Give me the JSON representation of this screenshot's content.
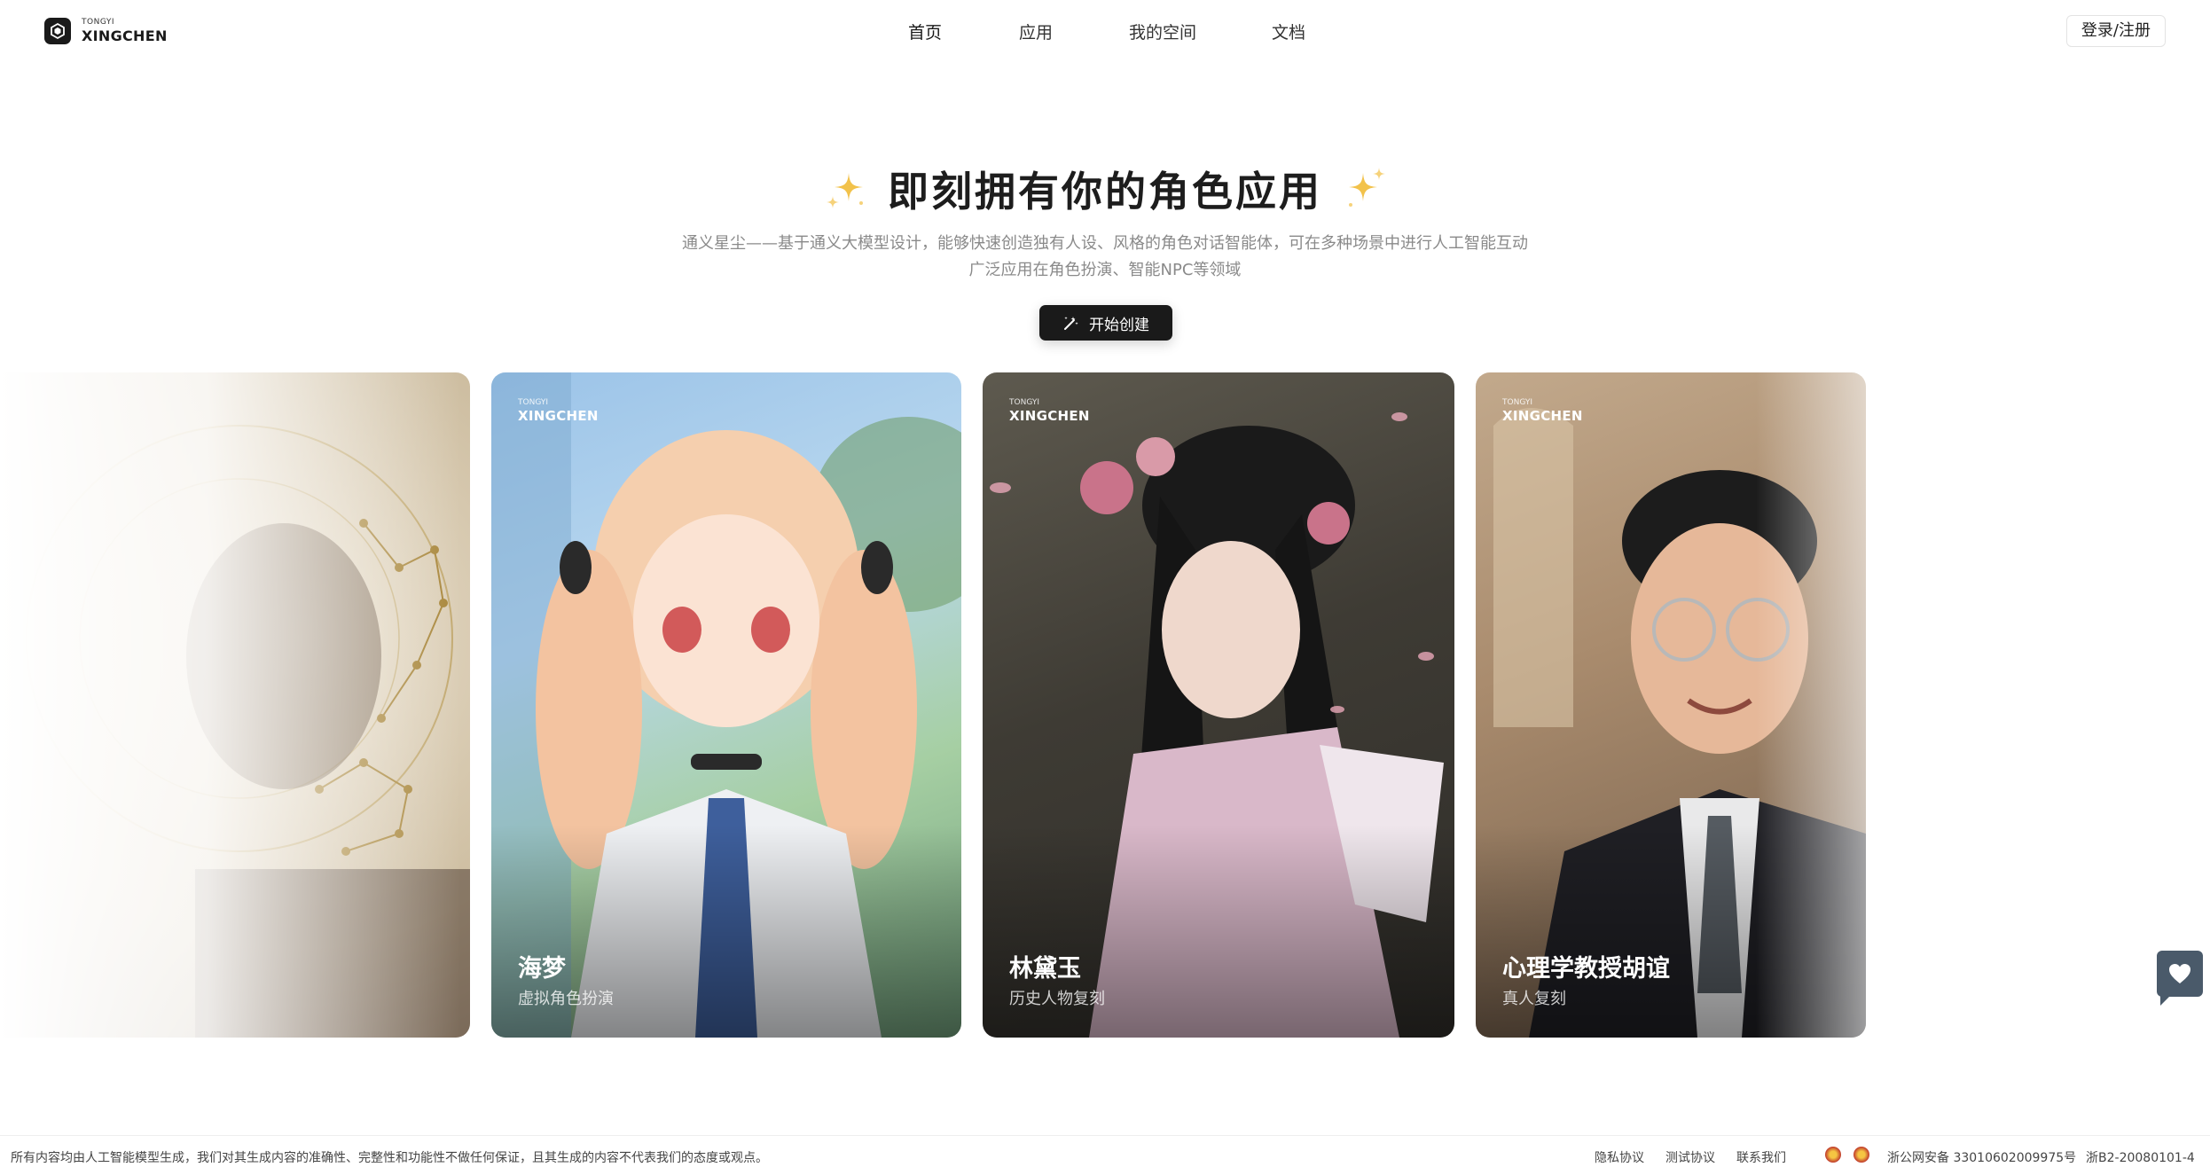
{
  "header": {
    "logo_small": "TONGYI",
    "logo_big": "XINGCHEN",
    "nav": [
      "首页",
      "应用",
      "我的空间",
      "文档"
    ],
    "active_nav": "首页",
    "login_label": "登录/注册"
  },
  "hero": {
    "title": "即刻拥有你的角色应用",
    "subtitle_line1": "通义星尘——基于通义大模型设计，能够快速创造独有人设、风格的角色对话智能体，可在多种场景中进行人工智能互动",
    "subtitle_line2": "广泛应用在角色扮演、智能NPC等领域",
    "create_label": "开始创建",
    "sparkle_color": "#f2c24b"
  },
  "cards": [
    {
      "brand_small": "",
      "brand_big": "",
      "name": "",
      "tag": ""
    },
    {
      "brand_small": "TONGYI",
      "brand_big": "XINGCHEN",
      "name": "海梦",
      "tag": "虚拟角色扮演"
    },
    {
      "brand_small": "TONGYI",
      "brand_big": "XINGCHEN",
      "name": "林黛玉",
      "tag": "历史人物复刻"
    },
    {
      "brand_small": "TONGYI",
      "brand_big": "XINGCHEN",
      "name": "心理学教授胡谊",
      "tag": "真人复刻"
    }
  ],
  "footer": {
    "disclaimer": "所有内容均由人工智能模型生成，我们对其生成内容的准确性、完整性和功能性不做任何保证，且其生成的内容不代表我们的态度或观点。",
    "privacy": "隐私协议",
    "test": "测试协议",
    "contact": "联系我们",
    "police_record": "浙公网安备 33010602009975号",
    "icp": "浙B2-20080101-4"
  },
  "feedback_icon": "heart-chat-icon"
}
